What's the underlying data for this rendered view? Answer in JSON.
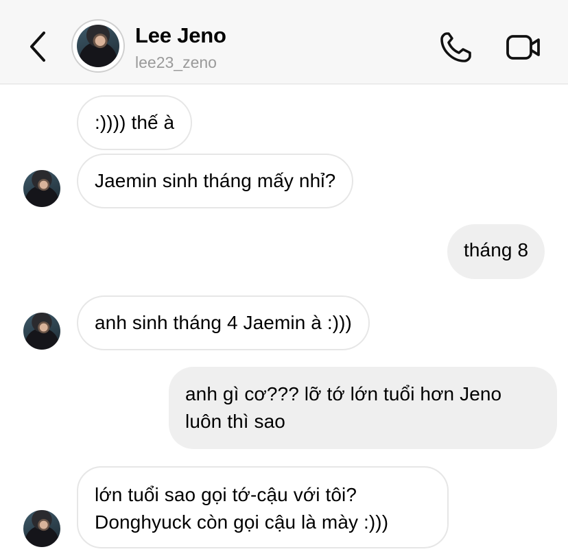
{
  "header": {
    "name": "Lee Jeno",
    "handle": "lee23_zeno"
  },
  "messages": [
    {
      "sender": "them",
      "text": ":)))) thế à"
    },
    {
      "sender": "them",
      "text": "Jaemin sinh tháng mấy nhỉ?"
    },
    {
      "sender": "me",
      "text": "tháng 8"
    },
    {
      "sender": "them",
      "text": "anh sinh tháng 4 Jaemin à :)))"
    },
    {
      "sender": "me",
      "lines": [
        "anh gì cơ??? lỡ tớ lớn tuổi hơn Jeno",
        "luôn thì sao"
      ]
    },
    {
      "sender": "them",
      "lines": [
        "lớn tuổi sao gọi tớ-cậu với tôi?",
        "Donghyuck còn gọi cậu là mày :)))"
      ]
    }
  ],
  "icons": {
    "back": "chevron-left-icon",
    "call": "phone-icon",
    "video": "video-camera-icon"
  },
  "colors": {
    "header_bg": "#f7f7f7",
    "incoming_border": "#e6e6e6",
    "outgoing_bg": "#efefef",
    "handle_text": "#9a9a9a"
  }
}
